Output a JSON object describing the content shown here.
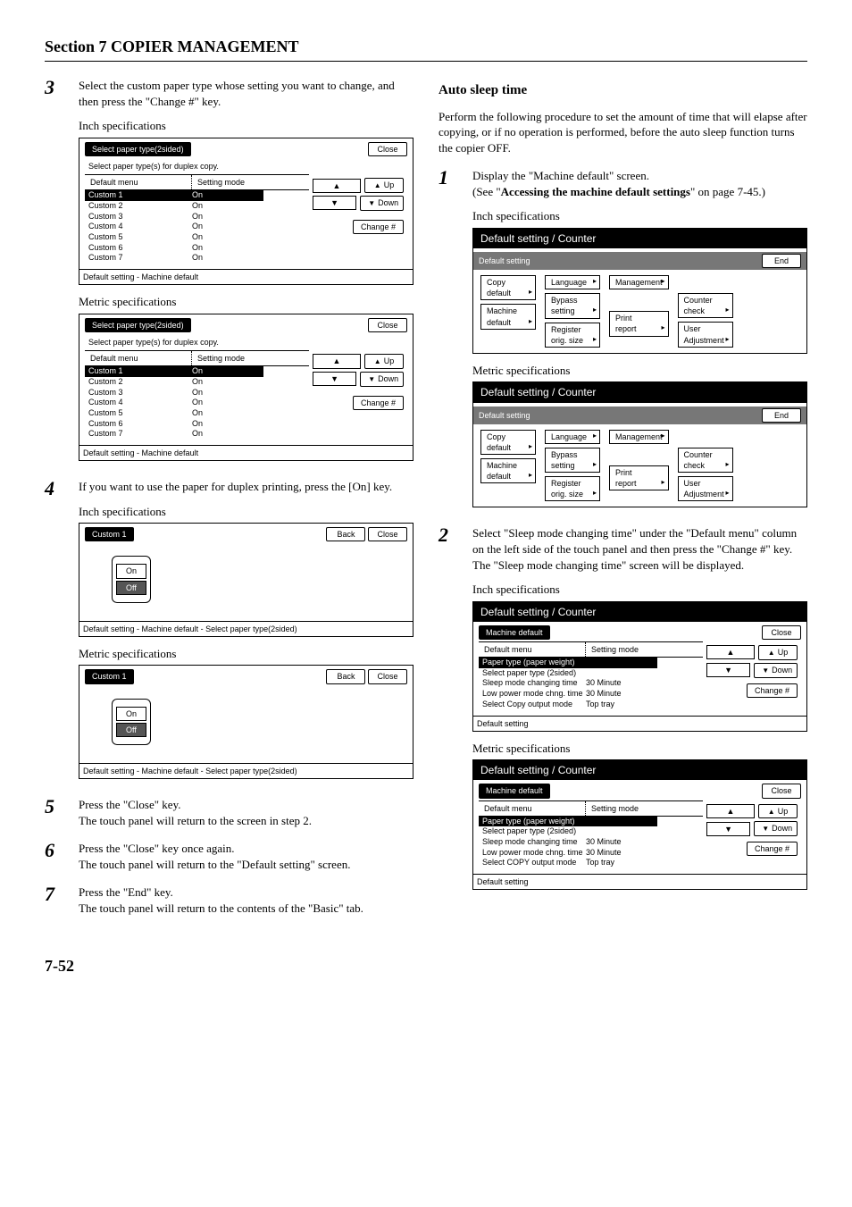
{
  "section_title": "Section 7  COPIER MANAGEMENT",
  "page_number": "7-52",
  "labels": {
    "inch_spec": "Inch specifications",
    "metric_spec": "Metric specifications"
  },
  "left": {
    "step3": "Select the custom paper type whose setting you want to change, and then press the \"Change #\" key.",
    "step4": "If you want to use the paper for duplex printing, press the [On] key.",
    "step5a": "Press the \"Close\" key.",
    "step5b": "The touch panel will return to the screen in step 2.",
    "step6a": "Press the \"Close\" key once again.",
    "step6b": "The touch panel will return to the \"Default setting\" screen.",
    "step7a": "Press the \"End\" key.",
    "step7b": "The touch panel will return to the contents of the \"Basic\" tab."
  },
  "right": {
    "heading": "Auto sleep time",
    "intro": "Perform the following procedure to set the amount of time that will elapse after copying, or if no operation is performed, before the auto sleep function turns the copier OFF.",
    "step1a": "Display the \"Machine default\" screen.",
    "step1b_pre": "(See \"",
    "step1b_bold": "Accessing the machine default settings",
    "step1b_post": "\" on page 7-45.)",
    "step2a": "Select \"Sleep mode changing time\" under the \"Default menu\" column on the left side of the touch panel and then press the \"Change #\" key.",
    "step2b": "The \"Sleep mode changing time\" screen will be displayed."
  },
  "panel_paper": {
    "tab": "Select paper type(2sided)",
    "sub": "Select paper type(s) for duplex copy.",
    "col1": "Default menu",
    "col2": "Setting mode",
    "rows": [
      {
        "n": "Custom 1",
        "v": "On",
        "sel": true
      },
      {
        "n": "Custom 2",
        "v": "On"
      },
      {
        "n": "Custom 3",
        "v": "On"
      },
      {
        "n": "Custom 4",
        "v": "On"
      },
      {
        "n": "Custom 5",
        "v": "On"
      },
      {
        "n": "Custom 6",
        "v": "On"
      },
      {
        "n": "Custom 7",
        "v": "On"
      }
    ],
    "close": "Close",
    "up": "Up",
    "down": "Down",
    "change": "Change #",
    "footer": "Default setting - Machine default"
  },
  "panel_onoff": {
    "tab": "Custom 1",
    "back": "Back",
    "close": "Close",
    "on": "On",
    "off": "Off",
    "footer": "Default setting - Machine default - Select paper type(2sided)"
  },
  "panel_default": {
    "title": "Default setting / Counter",
    "tab": "Default setting",
    "end": "End",
    "copy_default": "Copy\ndefault",
    "machine_default": "Machine\ndefault",
    "language": "Language",
    "bypass": "Bypass\nsetting",
    "register": "Register\norig. size",
    "management": "Management",
    "counter_check": "Counter\ncheck",
    "print_report": "Print\nreport",
    "user_adj": "User\nAdjustment"
  },
  "panel_machine": {
    "title": "Default setting / Counter",
    "tab": "Machine default",
    "close": "Close",
    "col1": "Default menu",
    "col2": "Setting mode",
    "rows_inch": [
      {
        "n": "Paper type (paper weight)",
        "sel": true
      },
      {
        "n": "Select paper type (2sided)"
      },
      {
        "n": "Sleep mode changing time",
        "v": "30 Minute"
      },
      {
        "n": "Low power mode chng. time",
        "v": "30 Minute"
      },
      {
        "n": "Select Copy output mode",
        "v": "Top tray"
      }
    ],
    "rows_metric": [
      {
        "n": "Paper type (paper weight)",
        "sel": true
      },
      {
        "n": "Select paper type (2sided)"
      },
      {
        "n": "Sleep mode changing time",
        "v": "30 Minute"
      },
      {
        "n": "Low power mode chng. time",
        "v": "30 Minute"
      },
      {
        "n": "Select COPY output mode",
        "v": "Top tray"
      }
    ],
    "up": "Up",
    "down": "Down",
    "change": "Change #",
    "footer": "Default setting"
  }
}
